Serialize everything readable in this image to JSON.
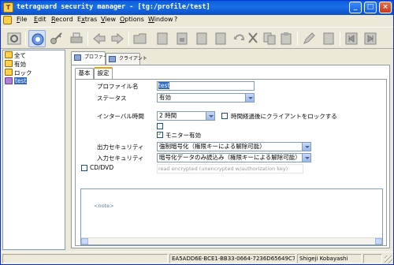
{
  "window": {
    "title": "tetraguard security manager - [tg:/profile/test]",
    "controls": {
      "minimize": "_",
      "maximize": "□",
      "close": "×"
    }
  },
  "menu": {
    "items": [
      {
        "label": "File",
        "key": "F"
      },
      {
        "label": "Edit",
        "key": "E"
      },
      {
        "label": "Record",
        "key": "R"
      },
      {
        "label": "Extras",
        "key": "x"
      },
      {
        "label": "View",
        "key": "V"
      },
      {
        "label": "Options",
        "key": "O"
      },
      {
        "label": "Window",
        "key": "W"
      },
      {
        "label": "?",
        "key": ""
      }
    ]
  },
  "toolbar": {
    "buttons": [
      "settings-icon",
      "profile-icon",
      "key-icon",
      "print-icon",
      "back-icon",
      "forward-icon",
      "folder-icon",
      "page-icon",
      "page-lock-icon",
      "page-icon",
      "page-icon",
      "page-icon",
      "undo-icon",
      "cut-icon",
      "copy-icon",
      "paste-icon",
      "edit-icon",
      "delete-icon",
      "export-icon",
      "import-icon"
    ]
  },
  "tree": {
    "items": [
      {
        "label": "全て",
        "icon": "folder-icon"
      },
      {
        "label": "有効",
        "icon": "folder-icon"
      },
      {
        "label": "ロック",
        "icon": "folder-icon"
      },
      {
        "label": "test",
        "icon": "profile-icon",
        "selected": true
      }
    ]
  },
  "tabs": {
    "top": [
      {
        "label": "プロファイル",
        "selected": true
      },
      {
        "label": "クライアント",
        "selected": false
      }
    ],
    "sub": [
      {
        "label": "基本",
        "selected": false
      },
      {
        "label": "設定",
        "selected": true
      }
    ]
  },
  "form": {
    "profile_name_label": "プロファイル名",
    "profile_name_value": "test",
    "status_label": "ステータス",
    "status_value": "有効",
    "interval_label": "インターバル時間",
    "interval_value": "2 時間",
    "lock_client_label": "時間経過後にクライアントをロックする",
    "lock_client_checked": false,
    "unnamed_checked": false,
    "monitor_label": "モニター有効",
    "monitor_checked": true,
    "output_security_label": "出力セキュリティ",
    "output_security_value": "強制暗号化（権限キーによる解除可能）",
    "input_security_label": "入力セキュリティ",
    "input_security_value": "暗号化データのみ読込み（権限キーによる解除可能）",
    "cddvd_label": "CD/DVD",
    "cddvd_checked": false,
    "cddvd_value": "read encrypted (unencrypted w/authorization key)",
    "note_placeholder": "<note>"
  },
  "status": {
    "id": "EA5ADD6E-BCE1-BB33-0664-7236D65649C7",
    "user": "Shigeji Kobayashi"
  },
  "colors": {
    "titlebar": "#0a5fd8",
    "selection": "#316ac5",
    "window_bg": "#ece9d8"
  }
}
